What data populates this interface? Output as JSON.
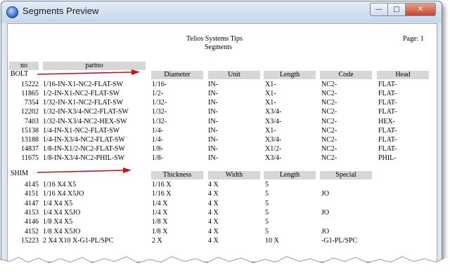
{
  "window": {
    "title": "Segments Preview"
  },
  "report": {
    "company": "Telios Systems Tips",
    "subtitle": "Segments",
    "page_label": "Page: 1",
    "col_no": "no",
    "col_partno": "partno"
  },
  "bolt": {
    "name": "BOLT",
    "headers": [
      "Diameter",
      "Unit",
      "Length",
      "Code",
      "Head"
    ],
    "rows": [
      [
        "15222",
        "1/16-IN-X1-NC2-FLAT-SW",
        "1/16-",
        "IN-",
        "X1-",
        "NC2-",
        "FLAT-"
      ],
      [
        "11865",
        "1/2-IN-X1-NC2-FLAT-SW",
        "1/2-",
        "IN-",
        "X1-",
        "NC2-",
        "FLAT-"
      ],
      [
        "7354",
        "1/32-IN-X1-NC2-FLAT-SW",
        "1/32-",
        "IN-",
        "X1-",
        "NC2-",
        "FLAT-"
      ],
      [
        "12202",
        "1/32-IN-X3/4-NC2-FLAT-SW",
        "1/32-",
        "IN-",
        "X3/4-",
        "NC2-",
        "FLAT-"
      ],
      [
        "7403",
        "1/32-IN-X3/4-NC2-HEX-SW",
        "1/32-",
        "IN-",
        "X3/4-",
        "NC2-",
        "HEX-"
      ],
      [
        "15138",
        "1/4-IN-X1-NC2-FLAT-SW",
        "1/4-",
        "IN-",
        "X1-",
        "NC2-",
        "FLAT-"
      ],
      [
        "13188",
        "1/4-IN-X3/4-NC2-FLAT-SW",
        "1/4-",
        "IN-",
        "X3/4-",
        "NC2-",
        "FLAT-"
      ],
      [
        "14837",
        "1/8-IN-X1/2-NC2-FLAT-SW",
        "1/8-",
        "IN-",
        "X1/2-",
        "NC2-",
        "FLAT-"
      ],
      [
        "11675",
        "1/8-IN-X3/4-NC2-PHIL-SW",
        "1/8-",
        "IN-",
        "X3/4-",
        "NC2-",
        "PHIL-"
      ]
    ]
  },
  "shim": {
    "name": "SHIM",
    "headers": [
      "Thickness",
      "Width",
      "Length",
      "Special"
    ],
    "rows": [
      [
        "4145",
        "1/16 X4 X5",
        "1/16 X",
        "4 X",
        "5",
        ""
      ],
      [
        "4151",
        "1/16 X4 X5JO",
        "1/16 X",
        "4 X",
        "5",
        "JO"
      ],
      [
        "4147",
        "1/4 X4 X5",
        "1/4 X",
        "4 X",
        "5",
        ""
      ],
      [
        "4153",
        "1/4 X4 X5JO",
        "1/4 X",
        "4 X",
        "5",
        "JO"
      ],
      [
        "4146",
        "1/8 X4 X5",
        "1/8 X",
        "4 X",
        "5",
        ""
      ],
      [
        "4152",
        "1/8 X4 X5JO",
        "1/8 X",
        "4 X",
        "5",
        "JO"
      ],
      [
        "15223",
        "2 X4 X10 X-G1-PL/SPC",
        "2 X",
        "4 X",
        "10 X",
        "-G1-PL/SPC"
      ]
    ]
  },
  "colors": {
    "arrow": "#c0141b",
    "header_fill": "#d7d7d7",
    "title_bar": "#c6d6ea"
  }
}
